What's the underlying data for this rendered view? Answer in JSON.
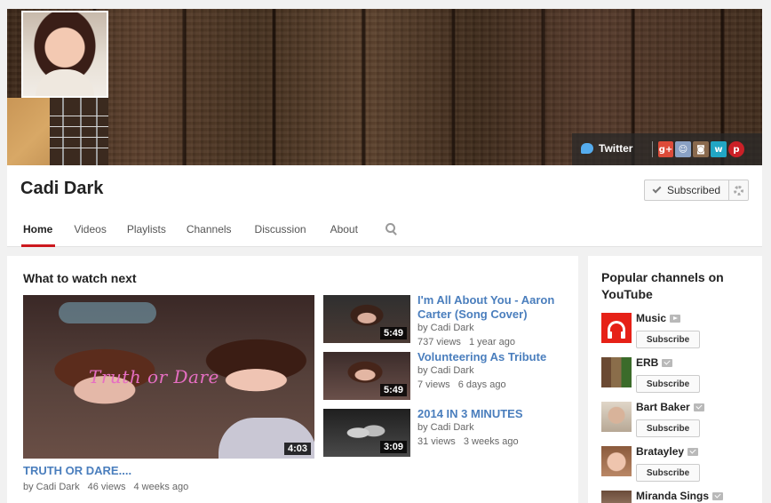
{
  "channel": {
    "name": "Cadi Dark",
    "subscribed_label": "Subscribed",
    "social": {
      "twitter_label": "Twitter",
      "icons": [
        "google-plus-icon",
        "photo-icon",
        "instagram-icon",
        "wattpad-icon",
        "pinterest-icon"
      ]
    }
  },
  "tabs": [
    {
      "label": "Home",
      "active": true
    },
    {
      "label": "Videos"
    },
    {
      "label": "Playlists"
    },
    {
      "label": "Channels"
    },
    {
      "label": "Discussion"
    },
    {
      "label": "About"
    }
  ],
  "main": {
    "section_title": "What to watch next",
    "featured": {
      "title": "TRUTH OR DARE....",
      "overlay_text": "Truth or Dare",
      "duration": "4:03",
      "by": "by Cadi Dark",
      "views": "46 views",
      "age": "4 weeks ago"
    },
    "videos": [
      {
        "title": "I'm All About You - Aaron Carter (Song Cover)",
        "duration": "5:49",
        "by": "by Cadi Dark",
        "views": "737 views",
        "age": "1 year ago"
      },
      {
        "title": "Volunteering As Tribute",
        "duration": "5:49",
        "by": "by Cadi Dark",
        "views": "7 views",
        "age": "6 days ago"
      },
      {
        "title": "2014 IN 3 MINUTES",
        "duration": "3:09",
        "by": "by Cadi Dark",
        "views": "31 views",
        "age": "3 weeks ago"
      }
    ]
  },
  "sidebar": {
    "title": "Popular channels on YouTube",
    "subscribe_label": "Subscribe",
    "channels": [
      {
        "name": "Music"
      },
      {
        "name": "ERB"
      },
      {
        "name": "Bart Baker"
      },
      {
        "name": "Bratayley"
      },
      {
        "name": "Miranda Sings"
      }
    ]
  },
  "colors": {
    "accent": "#cc181e",
    "link": "#4a7ebd",
    "youtube_red": "#e62117"
  }
}
